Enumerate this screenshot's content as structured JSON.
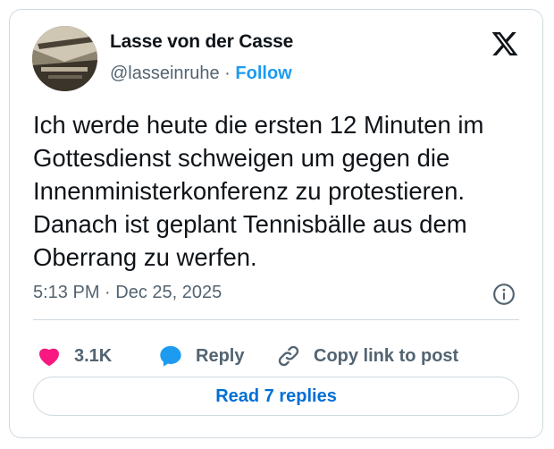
{
  "author": {
    "name": "Lasse von der Casse",
    "handle": "@lasseinruhe",
    "separator": "·",
    "follow_label": "Follow"
  },
  "tweet": {
    "text": "Ich werde heute die ersten 12 Minuten im\nGottesdienst schweigen um gegen die\nInnenministerkonferenz zu protestieren.\nDanach ist geplant Tennisbälle aus dem\nOberrang zu werfen.",
    "time": "5:13 PM",
    "date_separator": "·",
    "date": "Dec 25, 2025"
  },
  "actions": {
    "likes_count": "3.1K",
    "reply_label": "Reply",
    "copy_label": "Copy link to post"
  },
  "footer": {
    "read_replies_label": "Read 7 replies"
  },
  "icons": {
    "logo": "x-logo-icon",
    "info": "info-icon",
    "like": "heart-icon",
    "reply": "speech-bubble-icon",
    "copy": "link-icon"
  },
  "colors": {
    "heart": "#f91880",
    "reply_bubble": "#1d9bf0",
    "follow": "#1d9bf0",
    "read_replies": "#006fd6",
    "muted": "#536471",
    "border": "#cfd9de"
  }
}
